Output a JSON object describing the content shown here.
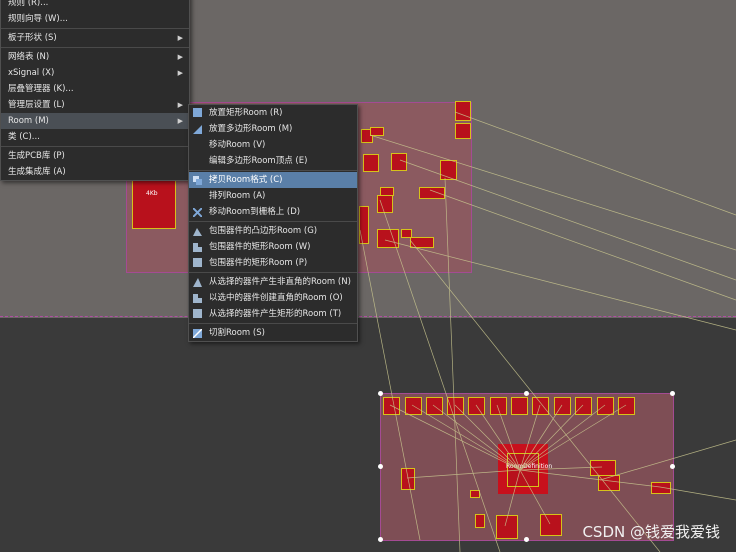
{
  "context_menu": {
    "items": [
      {
        "label": "规则 (R)...",
        "arrow": false
      },
      {
        "label": "规则向导 (W)...",
        "arrow": false
      },
      {
        "label": "板子形状 (S)",
        "arrow": true
      },
      {
        "label": "网络表 (N)",
        "arrow": true
      },
      {
        "label": "xSignal (X)",
        "arrow": true
      },
      {
        "label": "层叠管理器 (K)...",
        "arrow": false
      },
      {
        "label": "管理层设置 (L)",
        "arrow": true
      },
      {
        "label": "Room (M)",
        "arrow": true
      },
      {
        "label": "类 (C)...",
        "arrow": false
      },
      {
        "label": "生成PCB库 (P)",
        "arrow": false
      },
      {
        "label": "生成集成库 (A)",
        "arrow": false
      }
    ]
  },
  "room_submenu": {
    "items": [
      {
        "label": "放置矩形Room (R)",
        "icon": "rect-room-icon"
      },
      {
        "label": "放置多边形Room (M)",
        "icon": "polygon-room-icon"
      },
      {
        "label": "移动Room (V)",
        "icon": ""
      },
      {
        "label": "编辑多边形Room顶点 (E)",
        "icon": ""
      },
      {
        "label": "拷贝Room格式 (C)",
        "icon": "copy-format-icon"
      },
      {
        "label": "排列Room (A)",
        "icon": ""
      },
      {
        "label": "移动Room到栅格上 (D)",
        "icon": "grid-snap-icon"
      },
      {
        "label": "包围器件的凸边形Room (G)",
        "icon": "convex-room-icon"
      },
      {
        "label": "包围器件的矩形Room (W)",
        "icon": "orthogonal-room-icon"
      },
      {
        "label": "包围器件的矩形Room (P)",
        "icon": "rect-enclose-icon"
      },
      {
        "label": "从选择的器件产生非直角的Room (N)",
        "icon": "non-orth-icon"
      },
      {
        "label": "以选中的器件创建直角的Room (O)",
        "icon": "orth-create-icon"
      },
      {
        "label": "从选择的器件产生矩形的Room (T)",
        "icon": "rect-create-icon"
      },
      {
        "label": "切割Room (S)",
        "icon": "slice-room-icon"
      }
    ],
    "active_index": 4
  },
  "pcb": {
    "room_label": "RoomDefinition",
    "upper_room_label": "4Kb"
  },
  "watermark": "CSDN @钱爱我爱钱"
}
